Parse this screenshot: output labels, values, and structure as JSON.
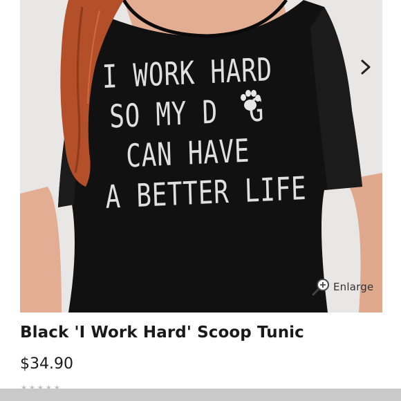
{
  "product": {
    "title": "Black 'I Work Hard' Scoop Tunic",
    "price": "$34.90",
    "shirt_print_lines": [
      "I WORK HARD",
      "SO MY D  G",
      "CAN HAVE",
      "A BETTER LIFE"
    ]
  },
  "gallery": {
    "enlarge_label": "Enlarge",
    "next_icon": "chevron-right-icon",
    "enlarge_icon": "magnifier-icon"
  },
  "colors": {
    "shirt": "#111111",
    "hair": "#b3502a",
    "skin": "#e2ad92",
    "background": "#e9e7e6"
  }
}
